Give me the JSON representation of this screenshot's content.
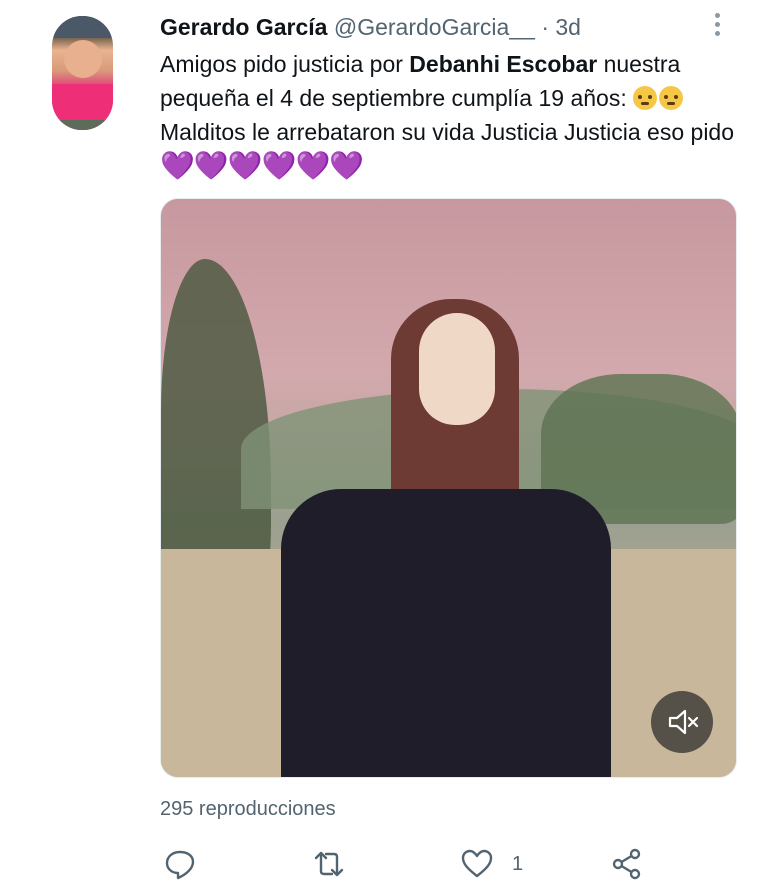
{
  "tweet": {
    "author_name": "Gerardo García",
    "handle": "@GerardoGarcia__",
    "separator": "·",
    "time": "3d",
    "text_part1": "Amigos pido justicia por ",
    "text_bold": "Debanhi Escobar",
    "text_part2": " nuestra pequeña el 4 de septiembre cumplía 19 años: ",
    "text_part3": " Malditos le arrebataron su vida Justicia Justicia eso pido ",
    "hearts": "💜💜💜💜💜💜",
    "views": "295 reproducciones",
    "like_count": "1"
  },
  "icons": {
    "more": "more-vertical-icon",
    "emoji1": "face-rolling-eyes-emoji",
    "emoji2": "disappointed-face-emoji",
    "mute": "volume-muted-icon",
    "reply": "reply-icon",
    "retweet": "retweet-icon",
    "like": "heart-icon",
    "share": "share-icon"
  },
  "colors": {
    "text": "#0f1419",
    "secondary": "#536471",
    "heart_emoji": "#a98fe4"
  }
}
